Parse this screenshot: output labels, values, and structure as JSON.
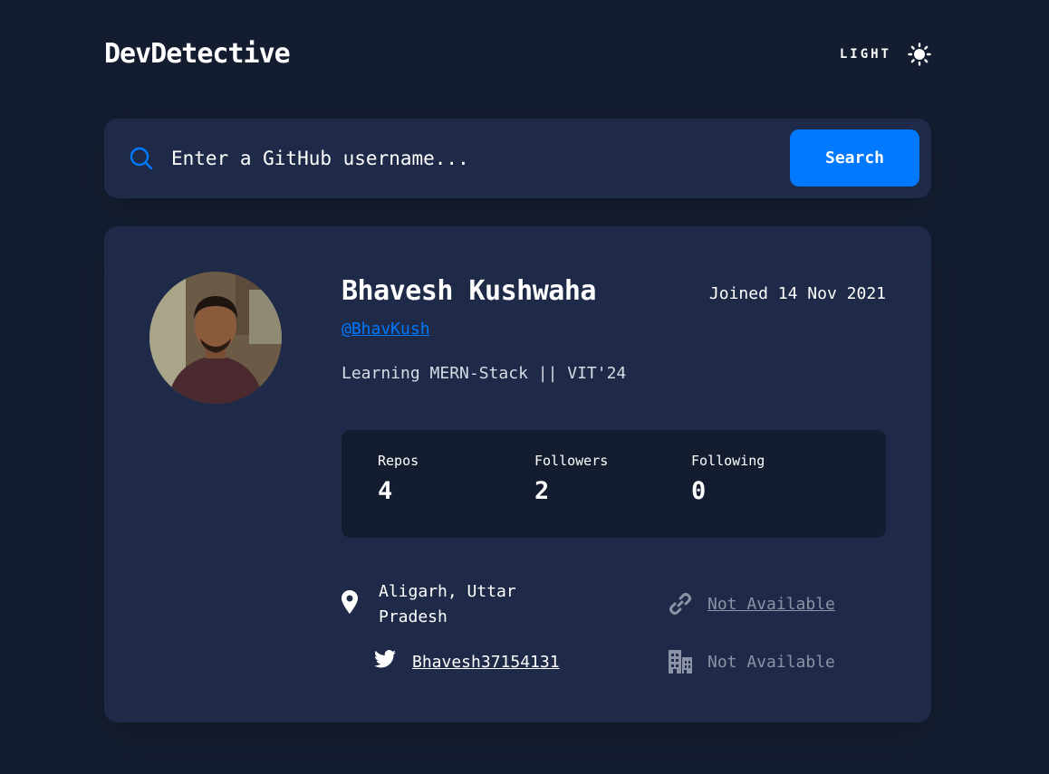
{
  "header": {
    "logo": "DevDetective",
    "theme_label": "LIGHT",
    "theme_icon": "sun-icon"
  },
  "search": {
    "icon": "search-icon",
    "placeholder": "Enter a GitHub username...",
    "value": "",
    "button_label": "Search"
  },
  "profile": {
    "name": "Bhavesh Kushwaha",
    "joined": "Joined 14 Nov 2021",
    "handle": "@BhavKush",
    "bio": "Learning MERN-Stack || VIT'24",
    "stats": {
      "repos": {
        "label": "Repos",
        "value": "4"
      },
      "followers": {
        "label": "Followers",
        "value": "2"
      },
      "following": {
        "label": "Following",
        "value": "0"
      }
    },
    "links": {
      "location": {
        "icon": "location-pin-icon",
        "text": "Aligarh, Uttar Pradesh"
      },
      "website": {
        "icon": "link-icon",
        "text": "Not Available"
      },
      "twitter": {
        "icon": "twitter-icon",
        "text": "Bhavesh37154131"
      },
      "company": {
        "icon": "company-building-icon",
        "text": "Not Available"
      }
    }
  },
  "colors": {
    "background": "#141d2f",
    "card": "#1e2a47",
    "accent": "#0079ff",
    "text": "#ffffff",
    "muted": "#8c93a6"
  }
}
